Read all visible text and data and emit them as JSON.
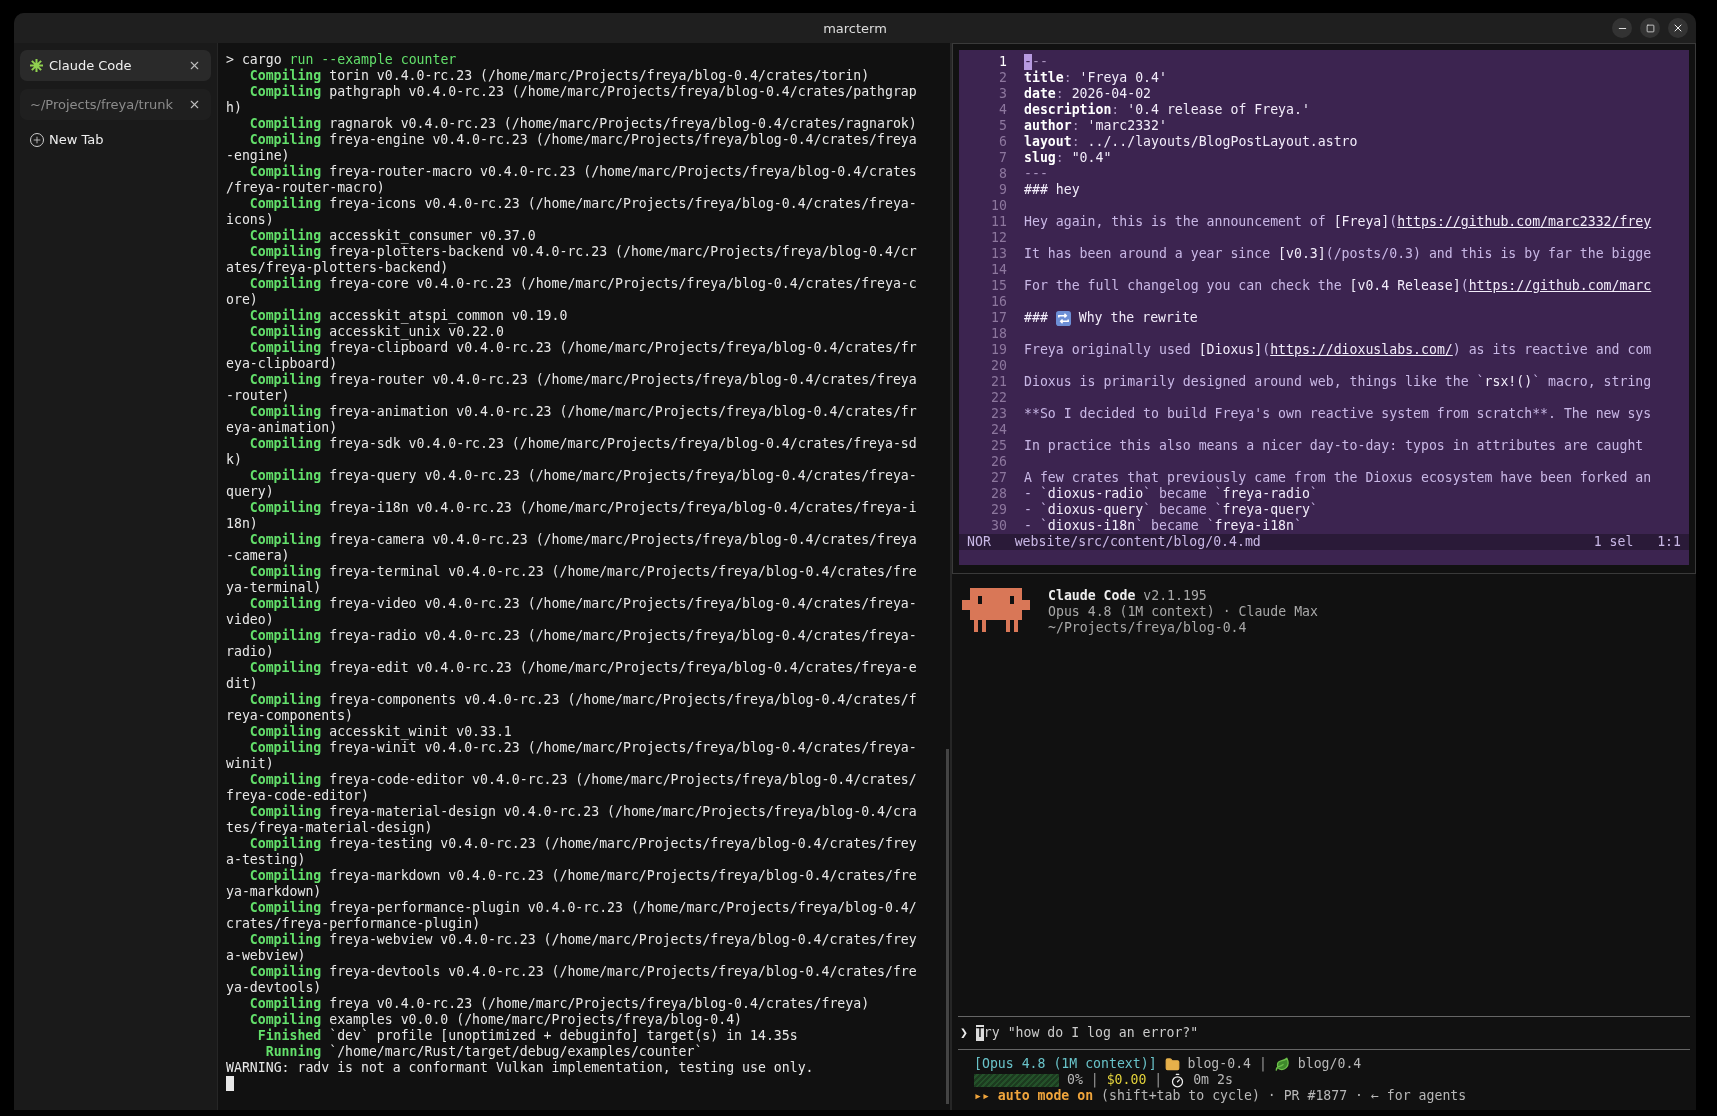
{
  "window": {
    "title": "marcterm"
  },
  "sidebar": {
    "tabs": [
      {
        "label": "Claude Code",
        "selected": true,
        "busy": true
      },
      {
        "label": "~/Projects/freya/trunk",
        "selected": false,
        "busy": false
      }
    ],
    "new_tab": "New Tab"
  },
  "terminal": {
    "lines": [
      {
        "kind": "prompt",
        "sign": ">",
        "command": "cargo",
        "args": "run --example counter"
      },
      {
        "kind": "status",
        "status": "Compiling",
        "text": "torin v0.4.0-rc.23 (/home/marc/Projects/freya/blog-0.4/crates/torin)"
      },
      {
        "kind": "status",
        "status": "Compiling",
        "text": "pathgraph v0.4.0-rc.23 (/home/marc/Projects/freya/blog-0.4/crates/pathgrap"
      },
      {
        "kind": "plain",
        "text": "h)"
      },
      {
        "kind": "status",
        "status": "Compiling",
        "text": "ragnarok v0.4.0-rc.23 (/home/marc/Projects/freya/blog-0.4/crates/ragnarok)"
      },
      {
        "kind": "status",
        "status": "Compiling",
        "text": "freya-engine v0.4.0-rc.23 (/home/marc/Projects/freya/blog-0.4/crates/freya"
      },
      {
        "kind": "plain",
        "text": "-engine)"
      },
      {
        "kind": "status",
        "status": "Compiling",
        "text": "freya-router-macro v0.4.0-rc.23 (/home/marc/Projects/freya/blog-0.4/crates"
      },
      {
        "kind": "plain",
        "text": "/freya-router-macro)"
      },
      {
        "kind": "status",
        "status": "Compiling",
        "text": "freya-icons v0.4.0-rc.23 (/home/marc/Projects/freya/blog-0.4/crates/freya-"
      },
      {
        "kind": "plain",
        "text": "icons)"
      },
      {
        "kind": "status",
        "status": "Compiling",
        "text": "accesskit_consumer v0.37.0"
      },
      {
        "kind": "status",
        "status": "Compiling",
        "text": "freya-plotters-backend v0.4.0-rc.23 (/home/marc/Projects/freya/blog-0.4/cr"
      },
      {
        "kind": "plain",
        "text": "ates/freya-plotters-backend)"
      },
      {
        "kind": "status",
        "status": "Compiling",
        "text": "freya-core v0.4.0-rc.23 (/home/marc/Projects/freya/blog-0.4/crates/freya-c"
      },
      {
        "kind": "plain",
        "text": "ore)"
      },
      {
        "kind": "status",
        "status": "Compiling",
        "text": "accesskit_atspi_common v0.19.0"
      },
      {
        "kind": "status",
        "status": "Compiling",
        "text": "accesskit_unix v0.22.0"
      },
      {
        "kind": "status",
        "status": "Compiling",
        "text": "freya-clipboard v0.4.0-rc.23 (/home/marc/Projects/freya/blog-0.4/crates/fr"
      },
      {
        "kind": "plain",
        "text": "eya-clipboard)"
      },
      {
        "kind": "status",
        "status": "Compiling",
        "text": "freya-router v0.4.0-rc.23 (/home/marc/Projects/freya/blog-0.4/crates/freya"
      },
      {
        "kind": "plain",
        "text": "-router)"
      },
      {
        "kind": "status",
        "status": "Compiling",
        "text": "freya-animation v0.4.0-rc.23 (/home/marc/Projects/freya/blog-0.4/crates/fr"
      },
      {
        "kind": "plain",
        "text": "eya-animation)"
      },
      {
        "kind": "status",
        "status": "Compiling",
        "text": "freya-sdk v0.4.0-rc.23 (/home/marc/Projects/freya/blog-0.4/crates/freya-sd"
      },
      {
        "kind": "plain",
        "text": "k)"
      },
      {
        "kind": "status",
        "status": "Compiling",
        "text": "freya-query v0.4.0-rc.23 (/home/marc/Projects/freya/blog-0.4/crates/freya-"
      },
      {
        "kind": "plain",
        "text": "query)"
      },
      {
        "kind": "status",
        "status": "Compiling",
        "text": "freya-i18n v0.4.0-rc.23 (/home/marc/Projects/freya/blog-0.4/crates/freya-i"
      },
      {
        "kind": "plain",
        "text": "18n)"
      },
      {
        "kind": "status",
        "status": "Compiling",
        "text": "freya-camera v0.4.0-rc.23 (/home/marc/Projects/freya/blog-0.4/crates/freya"
      },
      {
        "kind": "plain",
        "text": "-camera)"
      },
      {
        "kind": "status",
        "status": "Compiling",
        "text": "freya-terminal v0.4.0-rc.23 (/home/marc/Projects/freya/blog-0.4/crates/fre"
      },
      {
        "kind": "plain",
        "text": "ya-terminal)"
      },
      {
        "kind": "status",
        "status": "Compiling",
        "text": "freya-video v0.4.0-rc.23 (/home/marc/Projects/freya/blog-0.4/crates/freya-"
      },
      {
        "kind": "plain",
        "text": "video)"
      },
      {
        "kind": "status",
        "status": "Compiling",
        "text": "freya-radio v0.4.0-rc.23 (/home/marc/Projects/freya/blog-0.4/crates/freya-"
      },
      {
        "kind": "plain",
        "text": "radio)"
      },
      {
        "kind": "status",
        "status": "Compiling",
        "text": "freya-edit v0.4.0-rc.23 (/home/marc/Projects/freya/blog-0.4/crates/freya-e"
      },
      {
        "kind": "plain",
        "text": "dit)"
      },
      {
        "kind": "status",
        "status": "Compiling",
        "text": "freya-components v0.4.0-rc.23 (/home/marc/Projects/freya/blog-0.4/crates/f"
      },
      {
        "kind": "plain",
        "text": "reya-components)"
      },
      {
        "kind": "status",
        "status": "Compiling",
        "text": "accesskit_winit v0.33.1"
      },
      {
        "kind": "status",
        "status": "Compiling",
        "text": "freya-winit v0.4.0-rc.23 (/home/marc/Projects/freya/blog-0.4/crates/freya-"
      },
      {
        "kind": "plain",
        "text": "winit)"
      },
      {
        "kind": "status",
        "status": "Compiling",
        "text": "freya-code-editor v0.4.0-rc.23 (/home/marc/Projects/freya/blog-0.4/crates/"
      },
      {
        "kind": "plain",
        "text": "freya-code-editor)"
      },
      {
        "kind": "status",
        "status": "Compiling",
        "text": "freya-material-design v0.4.0-rc.23 (/home/marc/Projects/freya/blog-0.4/cra"
      },
      {
        "kind": "plain",
        "text": "tes/freya-material-design)"
      },
      {
        "kind": "status",
        "status": "Compiling",
        "text": "freya-testing v0.4.0-rc.23 (/home/marc/Projects/freya/blog-0.4/crates/frey"
      },
      {
        "kind": "plain",
        "text": "a-testing)"
      },
      {
        "kind": "status",
        "status": "Compiling",
        "text": "freya-markdown v0.4.0-rc.23 (/home/marc/Projects/freya/blog-0.4/crates/fre"
      },
      {
        "kind": "plain",
        "text": "ya-markdown)"
      },
      {
        "kind": "status",
        "status": "Compiling",
        "text": "freya-performance-plugin v0.4.0-rc.23 (/home/marc/Projects/freya/blog-0.4/"
      },
      {
        "kind": "plain",
        "text": "crates/freya-performance-plugin)"
      },
      {
        "kind": "status",
        "status": "Compiling",
        "text": "freya-webview v0.4.0-rc.23 (/home/marc/Projects/freya/blog-0.4/crates/frey"
      },
      {
        "kind": "plain",
        "text": "a-webview)"
      },
      {
        "kind": "status",
        "status": "Compiling",
        "text": "freya-devtools v0.4.0-rc.23 (/home/marc/Projects/freya/blog-0.4/crates/fre"
      },
      {
        "kind": "plain",
        "text": "ya-devtools)"
      },
      {
        "kind": "status",
        "status": "Compiling",
        "text": "freya v0.4.0-rc.23 (/home/marc/Projects/freya/blog-0.4/crates/freya)"
      },
      {
        "kind": "status",
        "status": "Compiling",
        "text": "examples v0.0.0 (/home/marc/Projects/freya/blog-0.4)"
      },
      {
        "kind": "status",
        "status": "Finished",
        "text": "`dev` profile [unoptimized + debuginfo] target(s) in 14.35s"
      },
      {
        "kind": "status",
        "status": "Running",
        "text": "`/home/marc/Rust/target/debug/examples/counter`"
      },
      {
        "kind": "plain",
        "text": "WARNING: radv is not a conformant Vulkan implementation, testing use only."
      },
      {
        "kind": "cursor"
      }
    ]
  },
  "editor": {
    "lines": [
      {
        "number": "1",
        "current": true,
        "parts": [
          {
            "kind": "cursor",
            "text": "-"
          },
          {
            "kind": "dim",
            "text": "--"
          }
        ]
      },
      {
        "number": "2",
        "current": false,
        "parts": [
          {
            "kind": "key",
            "text": "title"
          },
          {
            "kind": "dim",
            "text": ": "
          },
          {
            "kind": "strong",
            "text": "'Freya 0.4'"
          }
        ]
      },
      {
        "number": "3",
        "current": false,
        "parts": [
          {
            "kind": "key",
            "text": "date"
          },
          {
            "kind": "dim",
            "text": ": "
          },
          {
            "kind": "strong",
            "text": "2026-04-02"
          }
        ]
      },
      {
        "number": "4",
        "current": false,
        "parts": [
          {
            "kind": "key",
            "text": "description"
          },
          {
            "kind": "dim",
            "text": ": "
          },
          {
            "kind": "strong",
            "text": "'0.4 release of Freya.'"
          }
        ]
      },
      {
        "number": "5",
        "current": false,
        "parts": [
          {
            "kind": "key",
            "text": "author"
          },
          {
            "kind": "dim",
            "text": ": "
          },
          {
            "kind": "strong",
            "text": "'marc2332'"
          }
        ]
      },
      {
        "number": "6",
        "current": false,
        "parts": [
          {
            "kind": "key",
            "text": "layout"
          },
          {
            "kind": "dim",
            "text": ": "
          },
          {
            "kind": "strong",
            "text": "../../layouts/BlogPostLayout.astro"
          }
        ]
      },
      {
        "number": "7",
        "current": false,
        "parts": [
          {
            "kind": "key",
            "text": "slug"
          },
          {
            "kind": "dim",
            "text": ": "
          },
          {
            "kind": "strong",
            "text": "\"0.4\""
          }
        ]
      },
      {
        "number": "8",
        "current": false,
        "parts": [
          {
            "kind": "dim",
            "text": "---"
          }
        ]
      },
      {
        "number": "9",
        "current": false,
        "parts": [
          {
            "kind": "strong",
            "text": "### hey"
          }
        ]
      },
      {
        "number": "10",
        "current": false
      },
      {
        "number": "11",
        "current": false,
        "parts": [
          {
            "kind": "text",
            "text": "Hey again, this is the announcement of "
          },
          {
            "kind": "strong",
            "text": "[Freya]"
          },
          {
            "kind": "text",
            "text": "("
          },
          {
            "kind": "link",
            "text": "https://github.com/marc2332/frey"
          }
        ]
      },
      {
        "number": "12",
        "current": false
      },
      {
        "number": "13",
        "current": false,
        "parts": [
          {
            "kind": "text",
            "text": "It has been around a year since "
          },
          {
            "kind": "strong",
            "text": "[v0.3]"
          },
          {
            "kind": "text",
            "text": "(/posts/0.3) and this is by far the bigge"
          }
        ]
      },
      {
        "number": "14",
        "current": false
      },
      {
        "number": "15",
        "current": false,
        "parts": [
          {
            "kind": "text",
            "text": "For the full changelog you can check the "
          },
          {
            "kind": "strong",
            "text": "[v0.4 Release]"
          },
          {
            "kind": "text",
            "text": "("
          },
          {
            "kind": "link",
            "text": "https://github.com/marc"
          }
        ]
      },
      {
        "number": "16",
        "current": false
      },
      {
        "number": "17",
        "current": false,
        "parts": [
          {
            "kind": "strong",
            "text": "###"
          },
          {
            "kind": "icon"
          },
          {
            "kind": "strong",
            "text": "Why the rewrite"
          }
        ]
      },
      {
        "number": "18",
        "current": false
      },
      {
        "number": "19",
        "current": false,
        "parts": [
          {
            "kind": "text",
            "text": "Freya originally used "
          },
          {
            "kind": "strong",
            "text": "[Dioxus]"
          },
          {
            "kind": "text",
            "text": "("
          },
          {
            "kind": "link",
            "text": "https://dioxuslabs.com/"
          },
          {
            "kind": "text",
            "text": ") as its reactive and com"
          }
        ]
      },
      {
        "number": "20",
        "current": false
      },
      {
        "number": "21",
        "current": false,
        "parts": [
          {
            "kind": "text",
            "text": "Dioxus is primarily designed around web, things like the `"
          },
          {
            "kind": "strong",
            "text": "rsx!()"
          },
          {
            "kind": "text",
            "text": "` macro, string"
          }
        ]
      },
      {
        "number": "22",
        "current": false
      },
      {
        "number": "23",
        "current": false,
        "parts": [
          {
            "kind": "text",
            "text": "**So I decided to build Freya's own reactive system from scratch**. The new sys"
          }
        ]
      },
      {
        "number": "24",
        "current": false
      },
      {
        "number": "25",
        "current": false,
        "parts": [
          {
            "kind": "text",
            "text": "In practice this also means a nicer day-to-day: typos in attributes are caught"
          }
        ]
      },
      {
        "number": "26",
        "current": false
      },
      {
        "number": "27",
        "current": false,
        "parts": [
          {
            "kind": "text",
            "text": "A few crates that previously came from the Dioxus ecosystem have been forked an"
          }
        ]
      },
      {
        "number": "28",
        "current": false,
        "parts": [
          {
            "kind": "text",
            "text": "- `"
          },
          {
            "kind": "strong",
            "text": "dioxus-radio"
          },
          {
            "kind": "text",
            "text": "` became `"
          },
          {
            "kind": "strong",
            "text": "freya-radio"
          },
          {
            "kind": "text",
            "text": "`"
          }
        ]
      },
      {
        "number": "29",
        "current": false,
        "parts": [
          {
            "kind": "text",
            "text": "- `"
          },
          {
            "kind": "strong",
            "text": "dioxus-query"
          },
          {
            "kind": "text",
            "text": "` became `"
          },
          {
            "kind": "strong",
            "text": "freya-query"
          },
          {
            "kind": "text",
            "text": "`"
          }
        ]
      },
      {
        "number": "30",
        "current": false,
        "parts": [
          {
            "kind": "text",
            "text": "- `"
          },
          {
            "kind": "strong",
            "text": "dioxus-i18n"
          },
          {
            "kind": "text",
            "text": "` became `"
          },
          {
            "kind": "strong",
            "text": "freya-i18n"
          },
          {
            "kind": "text",
            "text": "`"
          }
        ]
      }
    ],
    "status_bar": {
      "mode": "NOR",
      "file": "website/src/content/blog/0.4.md",
      "selection": "1 sel",
      "position": "1:1"
    }
  },
  "assistant": {
    "name": "Claude Code",
    "version": "v2.1.195",
    "plan": "Opus 4.8 (1M context) · Claude Max",
    "directory": "~/Projects/freya/blog-0.4",
    "prompt_sign": "❯",
    "placeholder": "Try \"how do I log an error?\"",
    "status_lines": [
      [
        {
          "kind": "model",
          "text": "[Opus 4.8 (1M context)]"
        },
        {
          "kind": "folder"
        },
        {
          "kind": "text",
          "text": "blog-0.4"
        },
        {
          "kind": "dim",
          "text": "|"
        },
        {
          "kind": "branch"
        },
        {
          "kind": "text",
          "text": "blog/0.4"
        }
      ],
      [
        {
          "kind": "meter",
          "level": 0
        },
        {
          "kind": "text",
          "text": "0%"
        },
        {
          "kind": "dim",
          "text": "|"
        },
        {
          "kind": "cost",
          "text": "$0.00"
        },
        {
          "kind": "dim",
          "text": "|"
        },
        {
          "kind": "timer"
        },
        {
          "kind": "text",
          "text": "0m 2s"
        }
      ],
      [
        {
          "kind": "mode",
          "text": "▸▸ auto mode on"
        },
        {
          "kind": "text",
          "text": "(shift+tab to cycle) · PR #1877 · ← for agents"
        }
      ]
    ]
  }
}
